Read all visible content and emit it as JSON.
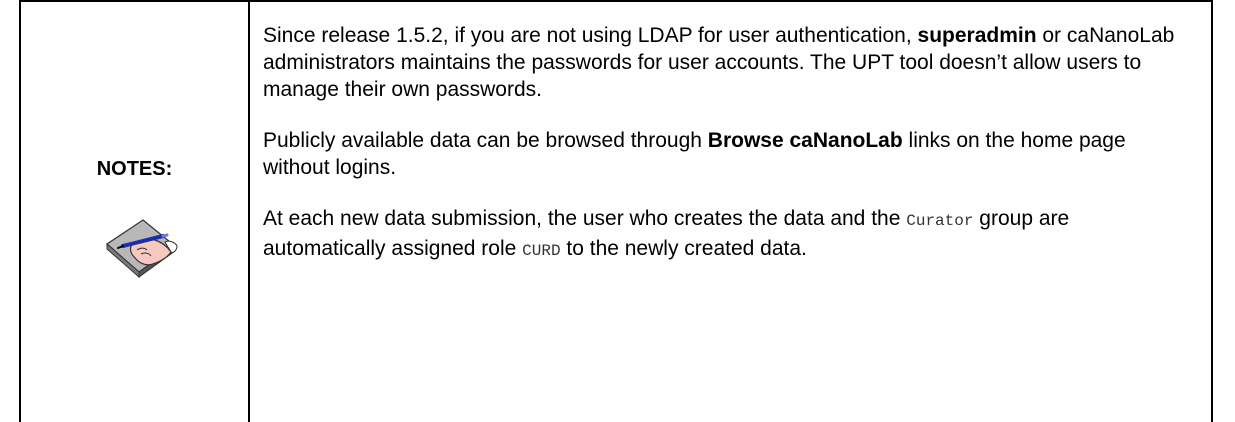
{
  "notes": {
    "label": "NOTES:",
    "icon": "notepad-pen-icon",
    "paragraphs": {
      "p1": {
        "part1": "Since release 1.5.2, if you are not using LDAP for user authentication, ",
        "bold1": "superadmin",
        "part2": " or caNanoLab administrators maintains the passwords for user accounts.  The UPT tool doesn’t allow users to manage their own passwords."
      },
      "p2": {
        "part1": "Publicly available data can be browsed through ",
        "bold1": "Browse caNanoLab",
        "part2": " links on the home page without logins."
      },
      "p3": {
        "part1": "At each new data submission, the user who creates the data and the ",
        "mono1": "Curator",
        "part2": " group are automatically assigned role ",
        "mono2": "CURD",
        "part3": " to the newly created data."
      }
    }
  }
}
